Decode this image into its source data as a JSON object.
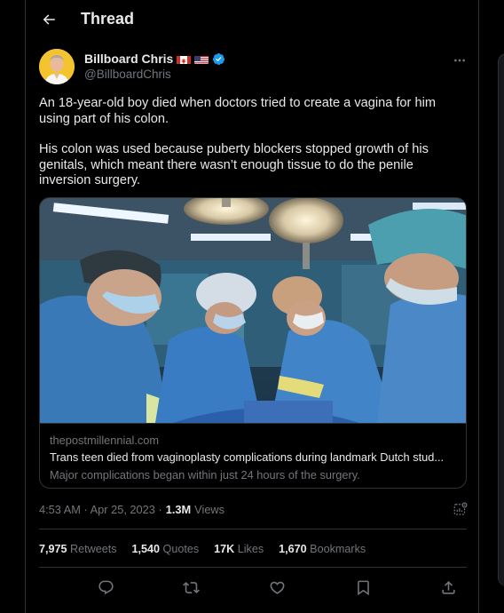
{
  "header": {
    "title": "Thread"
  },
  "author": {
    "name": "Billboard Chris",
    "handle": "@BillboardChris",
    "flags": [
      "canada-flag",
      "us-flag"
    ],
    "verified": true
  },
  "tweet": {
    "paragraphs": [
      "An 18-year-old boy died when doctors tried to create a vagina for him using part of his colon.",
      "His colon was used because puberty blockers stopped growth of his genitals, which meant there wasn’t enough tissue to do the penile inversion surgery."
    ]
  },
  "link_card": {
    "domain": "thepostmillennial.com",
    "title": "Trans teen died from vaginoplasty complications during landmark Dutch stud...",
    "description": "Major complications began within just 24 hours of the surgery.",
    "image_icon": "surgery-photo"
  },
  "meta": {
    "timestamp": "4:53 AM · Apr 25, 2023 ·",
    "views_count": "1.3M",
    "views_label": "Views"
  },
  "stats": [
    {
      "count": "7,975",
      "label": "Retweets"
    },
    {
      "count": "1,540",
      "label": "Quotes"
    },
    {
      "count": "17K",
      "label": "Likes"
    },
    {
      "count": "1,670",
      "label": "Bookmarks"
    }
  ],
  "actions": [
    "reply-icon",
    "retweet-icon",
    "like-icon",
    "bookmark-icon",
    "share-icon"
  ],
  "colors": {
    "background": "#000000",
    "text": "#e7e9ea",
    "secondary": "#71767b",
    "border": "#2f3336",
    "verified": "#1d9bf0"
  }
}
